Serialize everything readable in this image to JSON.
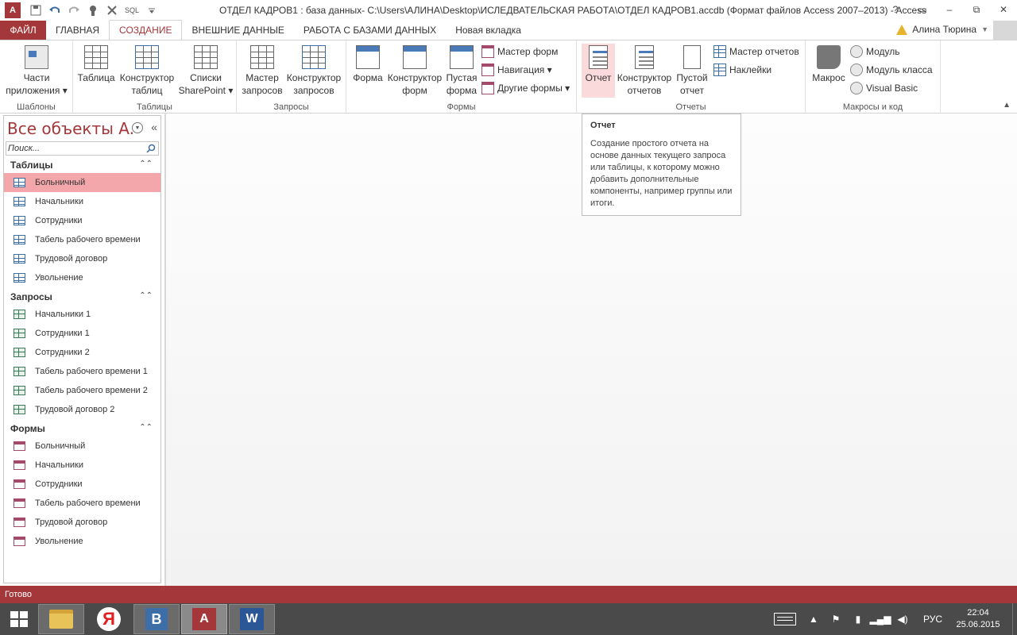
{
  "window": {
    "title": "ОТДЕЛ КАДРОВ1 : база данных- C:\\Users\\АЛИНА\\Desktop\\ИСЛЕДВАТЕЛЬСКАЯ РАБОТА\\ОТДЕЛ КАДРОВ1.accdb (Формат файлов Access 2007–2013) - Access",
    "app_logo": "A",
    "qat_sql": "SQL",
    "controls": [
      "?",
      "▭",
      "–",
      "⧉",
      "✕"
    ]
  },
  "tabs": [
    {
      "label": "ФАЙЛ"
    },
    {
      "label": "ГЛАВНАЯ"
    },
    {
      "label": "СОЗДАНИЕ"
    },
    {
      "label": "ВНЕШНИЕ ДАННЫЕ"
    },
    {
      "label": "РАБОТА С БАЗАМИ ДАННЫХ"
    },
    {
      "label": "Новая вкладка"
    }
  ],
  "user": {
    "name": "Алина Тюрина"
  },
  "ribbon": {
    "groups": {
      "templates": "Шаблоны",
      "tables": "Таблицы",
      "queries": "Запросы",
      "forms": "Формы",
      "reports": "Отчеты",
      "macros": "Макросы и код"
    },
    "buttons": {
      "app_parts": "Части\nприложения ▾",
      "table": "Таблица",
      "table_designer": "Конструктор\nтаблиц",
      "sharepoint_lists": "Списки\nSharePoint ▾",
      "query_wizard": "Мастер\nзапросов",
      "query_designer": "Конструктор\nзапросов",
      "form": "Форма",
      "form_designer": "Конструктор\nформ",
      "blank_form": "Пустая\nформа",
      "form_wizard": "Мастер форм",
      "navigation": "Навигация ▾",
      "other_forms": "Другие формы ▾",
      "report": "Отчет",
      "report_designer": "Конструктор\nотчетов",
      "blank_report": "Пустой\nотчет",
      "report_wizard": "Мастер отчетов",
      "labels": "Наклейки",
      "macro": "Макрос",
      "module": "Модуль",
      "class_module": "Модуль класса",
      "visual_basic": "Visual Basic"
    }
  },
  "nav": {
    "title": "Все объекты A...",
    "search_placeholder": "Поиск...",
    "categories": [
      {
        "label": "Таблицы",
        "items": [
          "Больничный",
          "Начальники",
          "Сотрудники",
          "Табель рабочего времени",
          "Трудовой договор",
          "Увольнение"
        ]
      },
      {
        "label": "Запросы",
        "items": [
          "Начальники 1",
          "Сотрудники 1",
          "Сотрудники 2",
          "Табель рабочего времени 1",
          "Табель рабочего времени 2",
          "Трудовой договор 2"
        ]
      },
      {
        "label": "Формы",
        "items": [
          "Больничный",
          "Начальники",
          "Сотрудники",
          "Табель рабочего времени",
          "Трудовой договор",
          "Увольнение"
        ]
      }
    ]
  },
  "tooltip": {
    "title": "Отчет",
    "body": "Создание простого отчета на основе данных текущего запроса или таблицы, к которому можно добавить дополнительные компоненты, например группы или итоги."
  },
  "status": {
    "text": "Готово"
  },
  "taskbar": {
    "lang": "РУС",
    "time": "22:04",
    "date": "25.06.2015",
    "yandex": "Я",
    "b_app": "B",
    "access": "A",
    "word": "W"
  },
  "colors": {
    "accent": "#a4373a",
    "selected": "#f4a7aa",
    "hover": "#fbdadb"
  }
}
